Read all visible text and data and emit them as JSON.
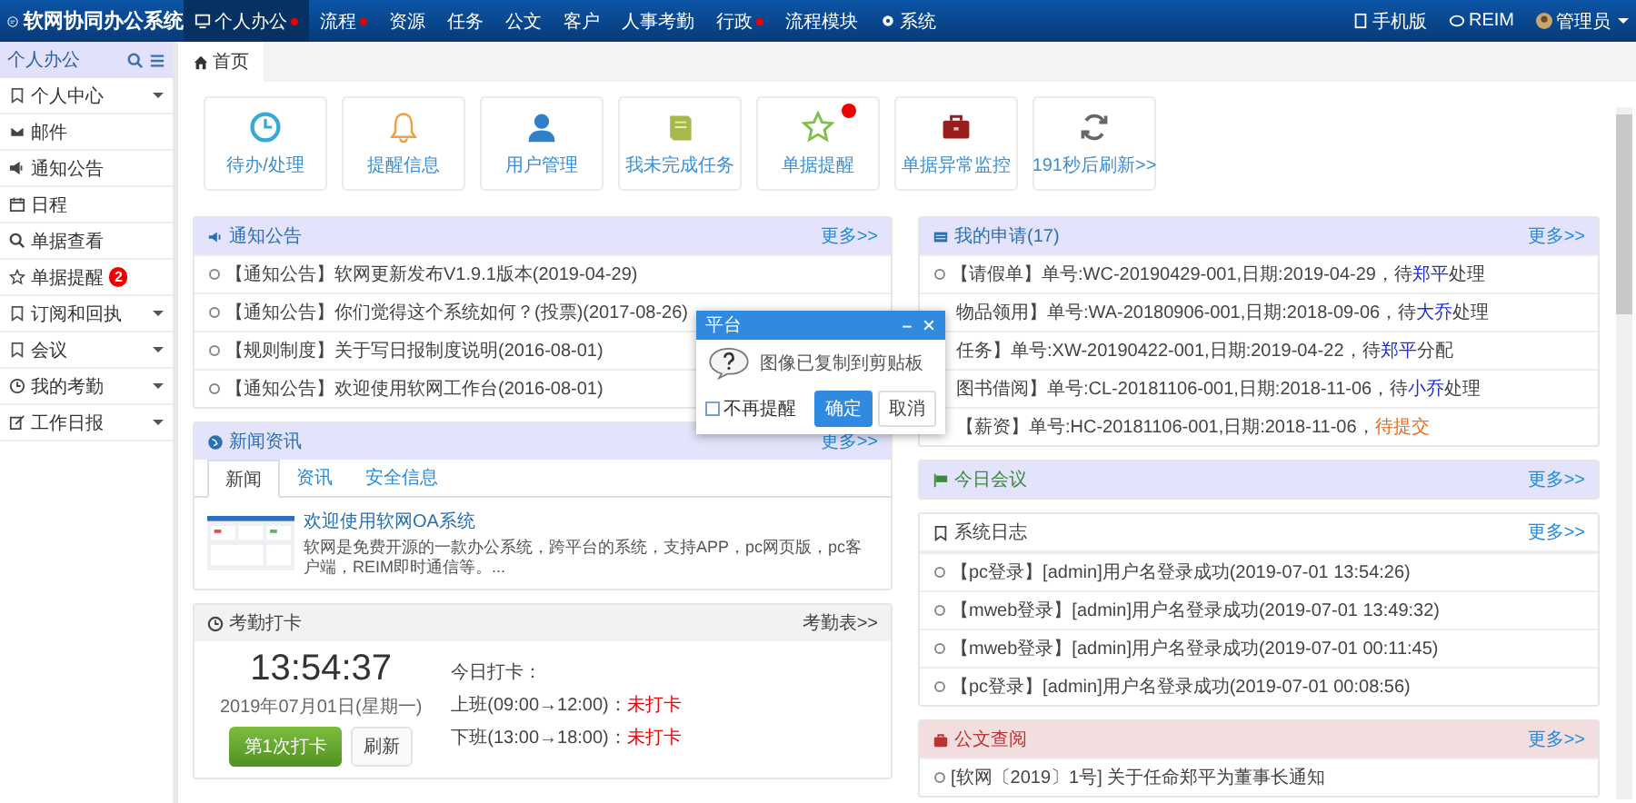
{
  "app_title": "软网协同办公系统",
  "nav": [
    {
      "label": "个人办公",
      "selected": true,
      "dot": true,
      "kind": "text"
    },
    {
      "label": "流程",
      "selected": false,
      "dot": true,
      "kind": "text"
    },
    {
      "label": "资源",
      "selected": false,
      "dot": false,
      "kind": "text"
    },
    {
      "label": "任务",
      "selected": false,
      "dot": false,
      "kind": "text"
    },
    {
      "label": "公文",
      "selected": false,
      "dot": false,
      "kind": "text"
    },
    {
      "label": "客户",
      "selected": false,
      "dot": false,
      "kind": "text"
    },
    {
      "label": "人事考勤",
      "selected": false,
      "dot": false,
      "kind": "text"
    },
    {
      "label": "行政",
      "selected": false,
      "dot": true,
      "kind": "text"
    },
    {
      "label": "流程模块",
      "selected": false,
      "dot": false,
      "kind": "text"
    },
    {
      "label": "系统",
      "selected": false,
      "dot": false,
      "kind": "settings"
    }
  ],
  "top_links": [
    {
      "label": "手机版"
    },
    {
      "label": "REIM"
    }
  ],
  "user": {
    "name": "管理员"
  },
  "sidebar": {
    "title": "个人办公",
    "items": [
      {
        "label": "个人中心",
        "expandable": true
      },
      {
        "label": "邮件",
        "expandable": false
      },
      {
        "label": "通知公告",
        "expandable": false
      },
      {
        "label": "日程",
        "expandable": false
      },
      {
        "label": "单据查看",
        "expandable": false
      },
      {
        "label": "单据提醒",
        "expandable": false,
        "badge": "2"
      },
      {
        "label": "订阅和回执",
        "expandable": true
      },
      {
        "label": "会议",
        "expandable": true
      },
      {
        "label": "我的考勤",
        "expandable": true
      },
      {
        "label": "工作日报",
        "expandable": true
      }
    ]
  },
  "page_tabs": [
    {
      "label": "首页",
      "selected": true
    }
  ],
  "tiles": [
    {
      "label": "待办/处理",
      "alert": false
    },
    {
      "label": "提醒信息",
      "alert": false
    },
    {
      "label": "用户管理",
      "alert": false
    },
    {
      "label": "我未完成任务",
      "alert": false
    },
    {
      "label": "单据提醒",
      "alert": true
    },
    {
      "label": "单据异常监控",
      "alert": false
    },
    {
      "label": "191秒后刷新>>",
      "alert": false
    }
  ],
  "notice_panel": {
    "title": "通知公告",
    "more": "更多>>",
    "rows": [
      "【通知公告】软网更新发布V1.9.1版本(2019-04-29)",
      "【通知公告】你们觉得这个系统如何？(投票)(2017-08-26)",
      "【规则制度】关于写日报制度说明(2016-08-01)",
      "【通知公告】欢迎使用软网工作台(2016-08-01)"
    ]
  },
  "news_panel": {
    "title": "新闻资讯",
    "more": "更多>>",
    "tabs": [
      {
        "label": "新闻",
        "selected": true
      },
      {
        "label": "资讯",
        "selected": false
      },
      {
        "label": "安全信息",
        "selected": false
      }
    ],
    "item": {
      "title": "欢迎使用软网OA系统",
      "summary": "软网是免费开源的一款办公系统，跨平台的系统，支持APP，pc网页版，pc客户端，REIM即时通信等。..."
    }
  },
  "attendance_panel": {
    "title": "考勤打卡",
    "more": "考勤表>>",
    "time": "13:54:37",
    "date": "2019年07月01日(星期一)",
    "punch_button": "第1次打卡",
    "refresh_button": "刷新",
    "today_label": "今日打卡：",
    "shifts": [
      {
        "label": "上班(09:00→12:00)：",
        "status": "未打卡"
      },
      {
        "label": "下班(13:00→18:00)：",
        "status": "未打卡"
      }
    ]
  },
  "apply_panel": {
    "title": "我的申请(17)",
    "more": "更多>>",
    "rows": [
      {
        "bullet": true,
        "parts": [
          {
            "text": "【请假单】单号:WC-20190429-001,日期:2019-04-29，待",
            "kind": "plain"
          },
          {
            "text": "郑平",
            "kind": "person"
          },
          {
            "text": "处理",
            "kind": "plain"
          }
        ]
      },
      {
        "bullet": false,
        "parts": [
          {
            "text": "物品领用】单号:WA-20180906-001,日期:2018-09-06，待",
            "kind": "plain"
          },
          {
            "text": "大乔",
            "kind": "person"
          },
          {
            "text": "处理",
            "kind": "plain"
          }
        ]
      },
      {
        "bullet": false,
        "parts": [
          {
            "text": "任务】单号:XW-20190422-001,日期:2019-04-22，待",
            "kind": "plain"
          },
          {
            "text": "郑平",
            "kind": "person"
          },
          {
            "text": "分配",
            "kind": "plain"
          }
        ]
      },
      {
        "bullet": false,
        "parts": [
          {
            "text": "图书借阅】单号:CL-20181106-001,日期:2018-11-06，待",
            "kind": "plain"
          },
          {
            "text": "小乔",
            "kind": "person"
          },
          {
            "text": "处理",
            "kind": "plain"
          }
        ]
      },
      {
        "bullet": false,
        "parts": [
          {
            "text": "【薪资】单号:HC-20181106-001,日期:2018-11-06，",
            "kind": "plain"
          },
          {
            "text": "待提交",
            "kind": "status"
          }
        ]
      }
    ]
  },
  "meeting_panel": {
    "title": "今日会议",
    "more": "更多>>"
  },
  "log_panel": {
    "title": "系统日志",
    "more": "更多>>",
    "rows": [
      "【pc登录】[admin]用户名登录成功(2019-07-01 13:54:26)",
      "【mweb登录】[admin]用户名登录成功(2019-07-01 13:49:32)",
      "【mweb登录】[admin]用户名登录成功(2019-07-01 00:11:45)",
      "【pc登录】[admin]用户名登录成功(2019-07-01 00:08:56)"
    ]
  },
  "doc_panel": {
    "title": "公文查阅",
    "more": "更多>>",
    "rows": [
      "[软网〔2019〕1号] 关于任命郑平为董事长通知"
    ]
  },
  "dialog": {
    "title": "平台",
    "message": "图像已复制到剪贴板",
    "dont_remind": {
      "label": "不再提醒",
      "checked": false
    },
    "buttons": [
      {
        "label": "确定",
        "primary": true
      },
      {
        "label": "取消",
        "primary": false
      }
    ]
  }
}
